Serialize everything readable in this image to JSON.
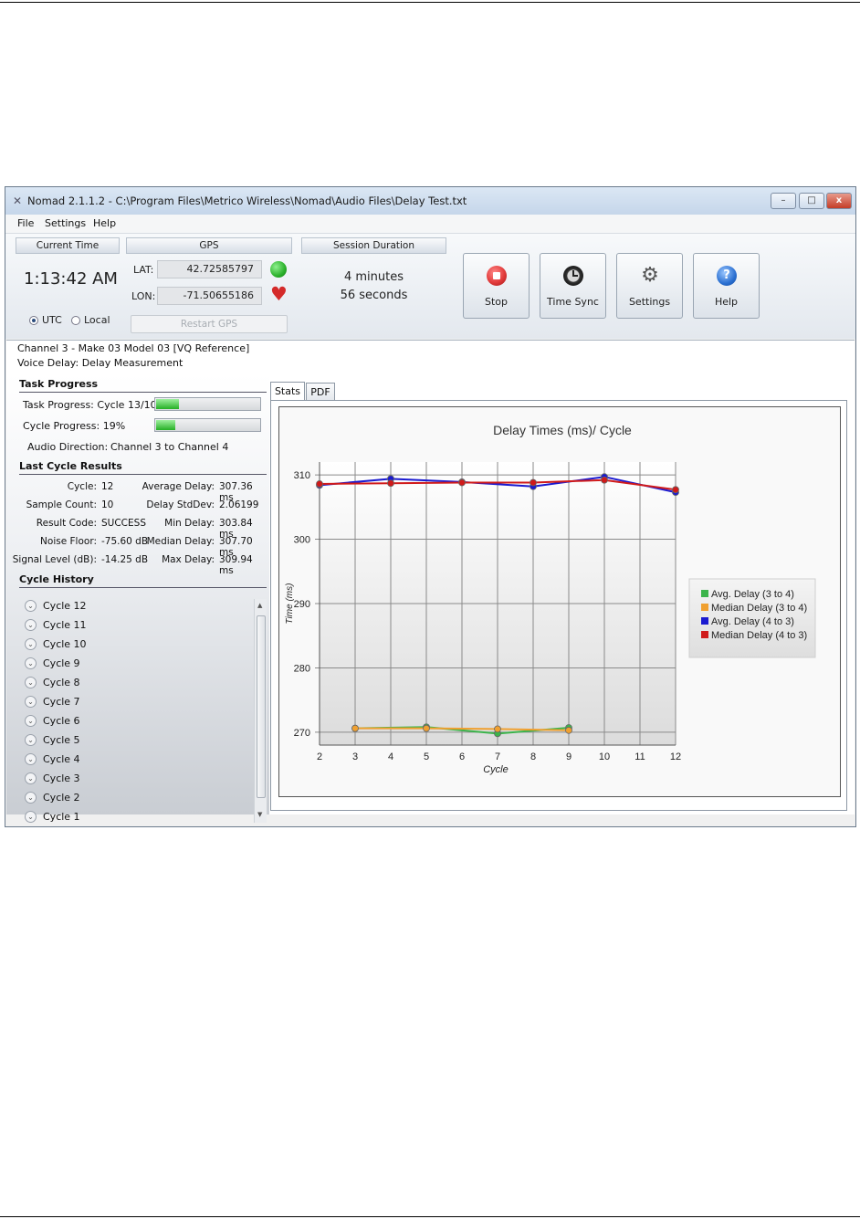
{
  "window": {
    "title": "Nomad 2.1.1.2 - C:\\Program Files\\Metrico Wireless\\Nomad\\Audio Files\\Delay Test.txt",
    "controls": [
      "–",
      "□",
      "x"
    ]
  },
  "menu": [
    "File",
    "Settings",
    "Help"
  ],
  "current_time": {
    "header": "Current Time",
    "value": "1:13:42 AM",
    "utc_label": "UTC",
    "local_label": "Local",
    "selected": "UTC"
  },
  "gps": {
    "header": "GPS",
    "lat_label": "LAT:",
    "lat_value": "42.72585797",
    "lon_label": "LON:",
    "lon_value": "-71.50655186",
    "status_color": "#2bb12b",
    "heart_color": "#d42a2a",
    "restart_label": "Restart GPS"
  },
  "session": {
    "header": "Session Duration",
    "line1": "4 minutes",
    "line2": "56 seconds"
  },
  "buttons": [
    {
      "label": "Stop",
      "icon": "stop-icon",
      "color": "#e23b3b"
    },
    {
      "label": "Time Sync",
      "icon": "clock-icon",
      "color": "#3a3a3a"
    },
    {
      "label": "Settings",
      "icon": "gear-icon",
      "color": "#555555"
    },
    {
      "label": "Help",
      "icon": "help-icon",
      "color": "#2a6fd1"
    }
  ],
  "channel": {
    "line1": "Channel 3 - Make 03 Model 03 [VQ Reference]",
    "line2": "Voice Delay: Delay Measurement"
  },
  "task_progress": {
    "header": "Task Progress",
    "task_label": "Task Progress: Cycle 13/100",
    "task_fraction": 0.13,
    "cycle_label": "Cycle Progress: 19%",
    "cycle_fraction": 0.19,
    "audio_label": "Audio Direction:",
    "audio_value": "Channel 3 to Channel 4"
  },
  "last_cycle": {
    "header": "Last Cycle Results",
    "left": [
      {
        "label": "Cycle:",
        "value": "12"
      },
      {
        "label": "Sample Count:",
        "value": "10"
      },
      {
        "label": "Result Code:",
        "value": "SUCCESS"
      },
      {
        "label": "Noise Floor:",
        "value": "-75.60 dB"
      },
      {
        "label": "Signal Level (dB):",
        "value": "-14.25 dB"
      }
    ],
    "right": [
      {
        "label": "Average Delay:",
        "value": "307.36 ms"
      },
      {
        "label": "Delay StdDev:",
        "value": "2.06199"
      },
      {
        "label": "Min Delay:",
        "value": "303.84 ms"
      },
      {
        "label": "Median Delay:",
        "value": "307.70 ms"
      },
      {
        "label": "Max Delay:",
        "value": "309.94 ms"
      }
    ]
  },
  "cycle_history": {
    "header": "Cycle History",
    "items": [
      "Cycle 12",
      "Cycle 11",
      "Cycle 10",
      "Cycle 9",
      "Cycle 8",
      "Cycle 7",
      "Cycle 6",
      "Cycle 5",
      "Cycle 4",
      "Cycle 3",
      "Cycle 2",
      "Cycle 1"
    ]
  },
  "tabs": [
    "Stats",
    "PDF"
  ],
  "chart_data": {
    "type": "line",
    "title": "Delay Times (ms)/ Cycle",
    "xlabel": "Cycle",
    "ylabel": "Time (ms)",
    "xlim": [
      2,
      12
    ],
    "ylim": [
      268,
      312
    ],
    "xticks": [
      2,
      3,
      4,
      5,
      6,
      7,
      8,
      9,
      10,
      11,
      12
    ],
    "yticks": [
      270,
      280,
      290,
      300,
      310
    ],
    "grid": true,
    "legend": "right",
    "series": [
      {
        "name": "Avg. Delay (3 to 4)",
        "color": "#3cb44b",
        "x": [
          3,
          5,
          7,
          9
        ],
        "y": [
          270.6,
          270.8,
          269.8,
          270.7
        ]
      },
      {
        "name": "Median Delay (3 to 4)",
        "color": "#f0a030",
        "x": [
          3,
          5,
          7,
          9
        ],
        "y": [
          270.6,
          270.6,
          270.5,
          270.3
        ]
      },
      {
        "name": "Avg. Delay (4 to 3)",
        "color": "#1a1ad0",
        "x": [
          2,
          4,
          6,
          8,
          10,
          12
        ],
        "y": [
          308.4,
          309.4,
          308.9,
          308.2,
          309.7,
          307.3
        ]
      },
      {
        "name": "Median Delay (4 to 3)",
        "color": "#d01a1a",
        "x": [
          2,
          4,
          6,
          8,
          10,
          12
        ],
        "y": [
          308.6,
          308.7,
          308.8,
          308.8,
          309.2,
          307.7
        ]
      }
    ]
  }
}
